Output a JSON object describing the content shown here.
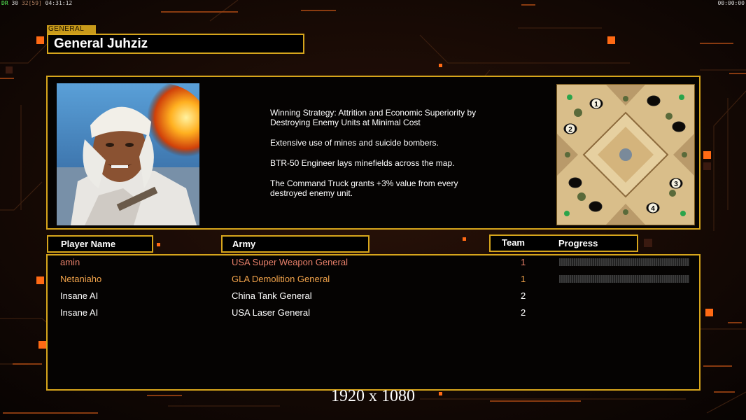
{
  "hud": {
    "left": {
      "c1": "DR",
      "c2": "30",
      "c3": "32[59]",
      "clock": "04:31:12"
    },
    "right_clock": "00:00:00"
  },
  "section_tag": "GENERAL",
  "general_name": "General Juhziz",
  "strategy": [
    "Winning Strategy: Attrition and Economic Superiority by\n Destroying Enemy Units at Minimal Cost",
    "Extensive use of mines and suicide bombers.",
    "BTR-50 Engineer lays minefields across the map.",
    "The Command Truck grants +3% value from every\n destroyed enemy unit."
  ],
  "minimap_starts": [
    "1",
    "2",
    "3",
    "4"
  ],
  "headers": {
    "player_name": "Player Name",
    "army": "Army",
    "team": "Team",
    "progress": "Progress"
  },
  "players": [
    {
      "name": "amin",
      "army": "USA Super Weapon General",
      "team": "1",
      "color": "#e8806a",
      "progress": 0.0
    },
    {
      "name": "Netaniaho",
      "army": "GLA Demolition General",
      "team": "1",
      "color": "#f0a24a",
      "progress": 0.0
    },
    {
      "name": "Insane AI",
      "army": "China Tank General",
      "team": "2",
      "color": "#ffffff"
    },
    {
      "name": "Insane AI",
      "army": "USA Laser General",
      "team": "2",
      "color": "#ffffff"
    }
  ],
  "resolution_text": "1920 x 1080",
  "colors": {
    "accent": "#d6a51c",
    "background": "#0b0604",
    "highlight": "#ff7a1a"
  }
}
